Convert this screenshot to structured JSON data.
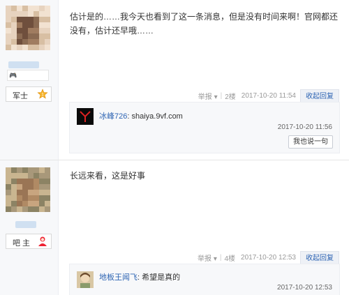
{
  "posts": [
    {
      "rank_label": "军士",
      "rank_icon": "level-badge-icon",
      "emoji_icons": "🎮",
      "content": "估计是的……我今天也看到了这一条消息，但是没有时间来啊！官网都还没有，估计还早哦……",
      "tail": {
        "report": "举报",
        "floor": "2楼",
        "time": "2017-10-20 11:54",
        "reply": "收起回复"
      },
      "replies": [
        {
          "user": "冰峰726",
          "text": "shaiya.9vf.com",
          "time": "2017-10-20 11:56"
        }
      ],
      "say_button": "我也说一句"
    },
    {
      "rank_label": "吧 主",
      "rank_icon": "admin-badge-icon",
      "content": "长远来看，这是好事",
      "tail": {
        "report": "举报",
        "floor": "4楼",
        "time": "2017-10-20 12:53",
        "reply": "收起回复"
      },
      "replies": [
        {
          "user": "地板王闻飞",
          "text": "希望是真的",
          "time": "2017-10-20 12:53"
        }
      ]
    }
  ],
  "icons": {
    "dropdown": "chevron-down-icon"
  }
}
